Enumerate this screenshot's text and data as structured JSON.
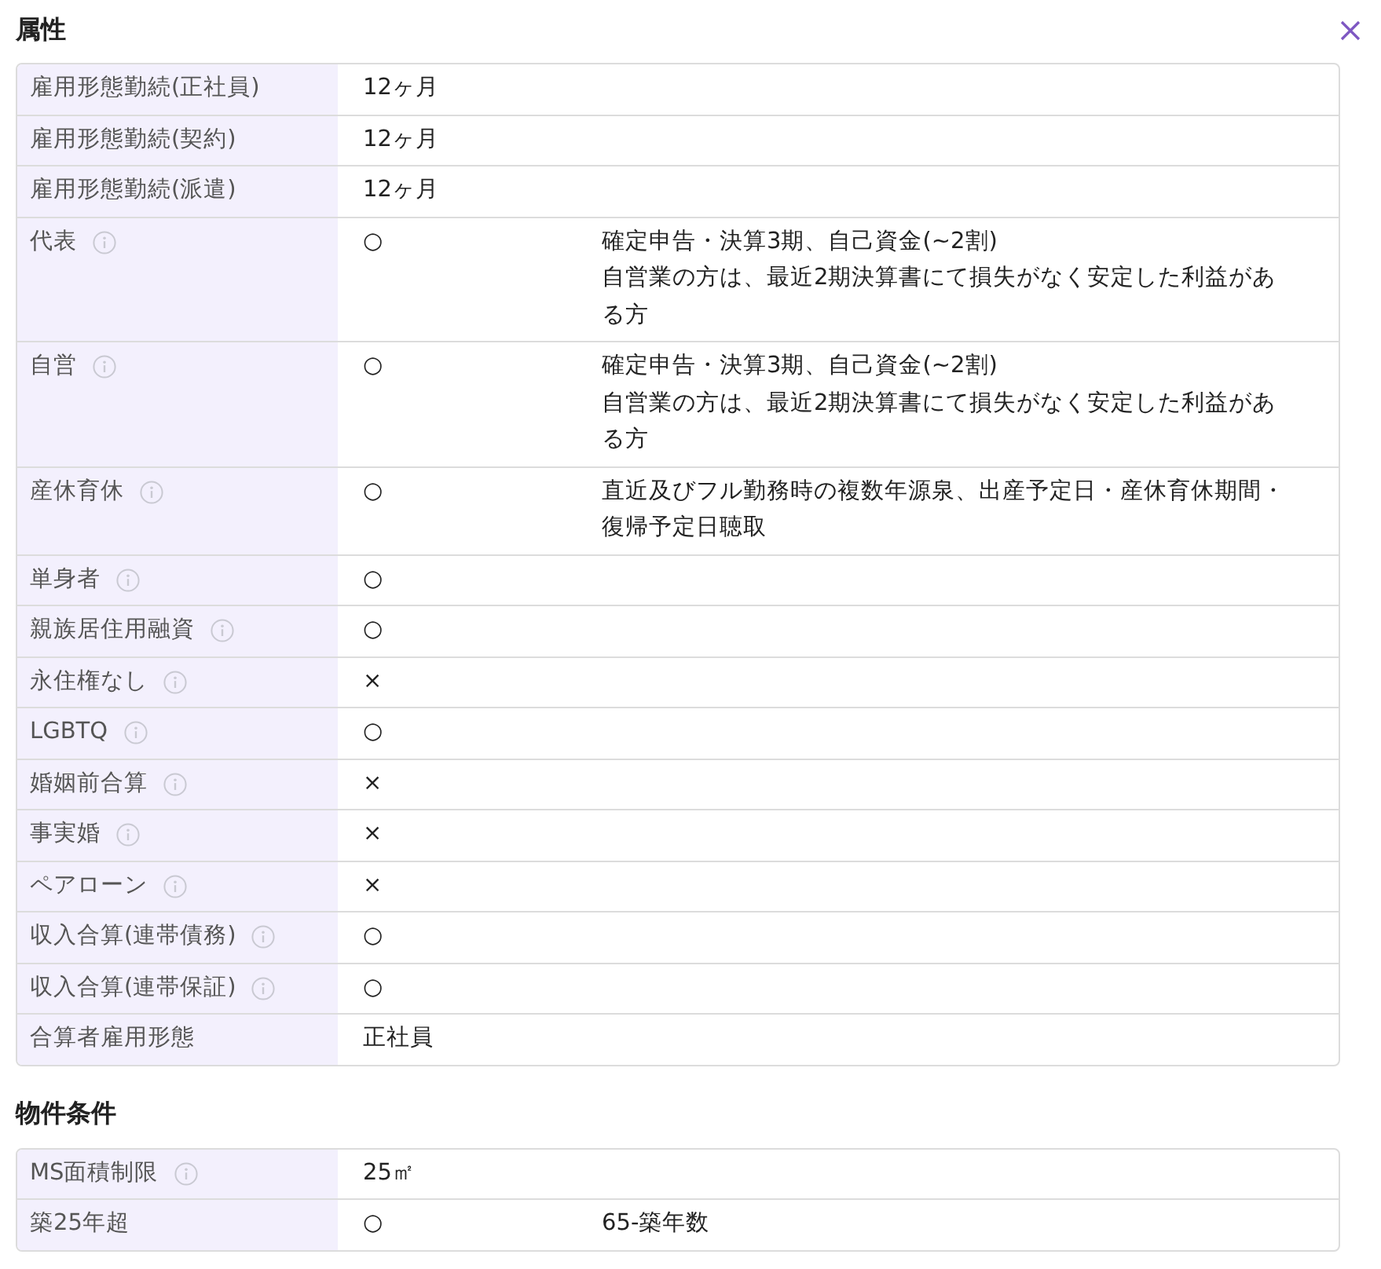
{
  "sections": [
    {
      "title": "属性",
      "closable": true,
      "rows": [
        {
          "label": "雇用形態勤続(正社員)",
          "info": false,
          "value": "12ヶ月"
        },
        {
          "label": "雇用形態勤続(契約)",
          "info": false,
          "value": "12ヶ月"
        },
        {
          "label": "雇用形態勤続(派遣)",
          "info": false,
          "value": "12ヶ月"
        },
        {
          "label": "代表",
          "info": true,
          "value": "○",
          "note": "確定申告・決算3期、自己資金(~2割)\n自営業の方は、最近2期決算書にて損失がなく安定した利益がある方"
        },
        {
          "label": "自営",
          "info": true,
          "value": "○",
          "note": "確定申告・決算3期、自己資金(~2割)\n自営業の方は、最近2期決算書にて損失がなく安定した利益がある方"
        },
        {
          "label": "産休育休",
          "info": true,
          "value": "○",
          "note": "直近及びフル勤務時の複数年源泉、出産予定日・産休育休期間・復帰予定日聴取"
        },
        {
          "label": "単身者",
          "info": true,
          "value": "○"
        },
        {
          "label": "親族居住用融資",
          "info": true,
          "value": "○"
        },
        {
          "label": "永住権なし",
          "info": true,
          "value": "×"
        },
        {
          "label": "LGBTQ",
          "info": true,
          "value": "○"
        },
        {
          "label": "婚姻前合算",
          "info": true,
          "value": "×"
        },
        {
          "label": "事実婚",
          "info": true,
          "value": "×"
        },
        {
          "label": "ペアローン",
          "info": true,
          "value": "×"
        },
        {
          "label": "収入合算(連帯債務)",
          "info": true,
          "value": "○"
        },
        {
          "label": "収入合算(連帯保証)",
          "info": true,
          "value": "○"
        },
        {
          "label": "合算者雇用形態",
          "info": false,
          "value": "正社員"
        }
      ]
    },
    {
      "title": "物件条件",
      "closable": false,
      "rows": [
        {
          "label": "MS面積制限",
          "info": true,
          "value": "25㎡"
        },
        {
          "label": "築25年超",
          "info": false,
          "value": "○",
          "note": "65-築年数"
        }
      ]
    }
  ]
}
